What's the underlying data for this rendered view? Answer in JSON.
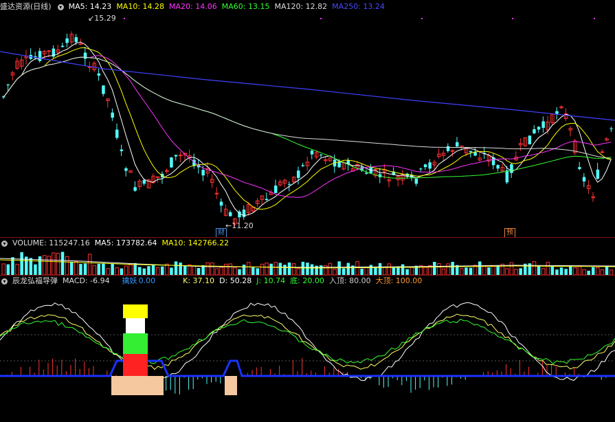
{
  "main": {
    "title": "盛达资源(日线)",
    "ma": [
      {
        "label": "MA5: 14.23",
        "color": "#ffffff"
      },
      {
        "label": "MA10: 14.28",
        "color": "#ffff00"
      },
      {
        "label": "MA20: 14.06",
        "color": "#ff33ff"
      },
      {
        "label": "MA60: 13.15",
        "color": "#33ff33"
      },
      {
        "label": "MA120: 12.82",
        "color": "#dddddd"
      },
      {
        "label": "MA250: 13.24",
        "color": "#4040ff"
      }
    ],
    "high_marker": "15.29",
    "low_marker": "11.20",
    "event_tags": [
      {
        "text": "财",
        "color": "#4a90e2"
      },
      {
        "text": "预",
        "color": "#e8823a"
      }
    ]
  },
  "volume": {
    "items": [
      {
        "label": "VOLUME: 115247.16",
        "color": "#dddddd"
      },
      {
        "label": "MA5: 173782.64",
        "color": "#ffffff"
      },
      {
        "label": "MA10: 142766.22",
        "color": "#ffff00"
      }
    ]
  },
  "indicator": {
    "items": [
      {
        "label": "辰龙弘福导弹",
        "color": "#dddddd"
      },
      {
        "label": "MACD: -6.94",
        "color": "#dddddd"
      },
      {
        "label": "擒妖",
        "color": "#3399ff"
      },
      {
        "label": "0.00",
        "color": "#3399ff"
      },
      {
        "label": "K: 37.10",
        "color": "#ffff66"
      },
      {
        "label": "D: 50.28",
        "color": "#ffffff"
      },
      {
        "label": "J: 10.74",
        "color": "#33ff33"
      },
      {
        "label": "底: 20.00",
        "color": "#33ff33"
      },
      {
        "label": "入顶: 80.00",
        "color": "#cccccc"
      },
      {
        "label": "大顶: 100.00",
        "color": "#ff9933"
      }
    ]
  },
  "colors": {
    "up": "#ff3232",
    "down": "#54fcfc",
    "ma5": "#ffffff",
    "ma10": "#ffff00",
    "ma20": "#ff33ff",
    "ma60": "#33ff33",
    "ma120": "#dddddd",
    "ma250": "#4040ff",
    "grid": "#8a1010"
  },
  "icons": [
    "collapse-circle-icon"
  ]
}
